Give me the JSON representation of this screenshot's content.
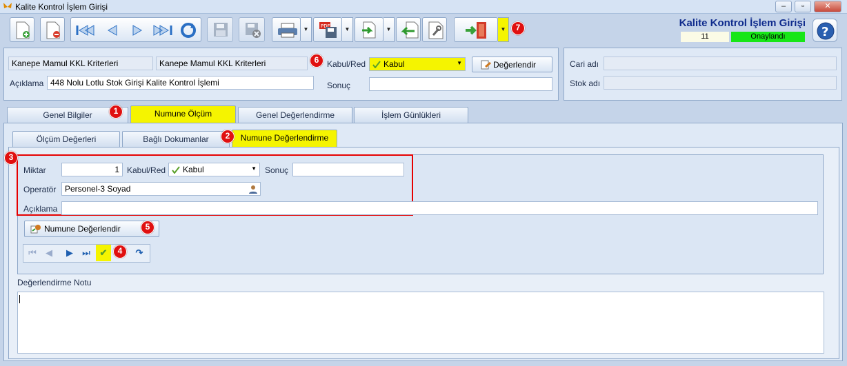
{
  "window": {
    "title": "Kalite Kontrol İşlem Girişi"
  },
  "header": {
    "title": "Kalite Kontrol İşlem Girişi",
    "record_no": "11",
    "status": "Onaylandı",
    "status_color": "#17e617"
  },
  "top": {
    "criteria1": "Kanepe Mamul KKL Kriterleri",
    "criteria2": "Kanepe Mamul KKL Kriterleri",
    "aciklama_label": "Açıklama",
    "aciklama_value": "448 Nolu Lotlu Stok Girişi Kalite Kontrol İşlemi",
    "kabulred_label": "Kabul/Red",
    "kabulred_value": "Kabul",
    "sonuc_label": "Sonuç",
    "sonuc_value": "",
    "degerlendir_label": "Değerlendir",
    "cari_label": "Cari adı",
    "stok_label": "Stok adı"
  },
  "tabs": [
    "Genel Bilgiler",
    "Numune Ölçüm",
    "Genel Değerlendirme",
    "İşlem Günlükleri"
  ],
  "subtabs": [
    "Ölçüm Değerleri",
    "Bağlı Dokumanlar",
    "Numune Değerlendirme"
  ],
  "form": {
    "miktar_label": "Miktar",
    "miktar_value": "1",
    "kabulred_label": "Kabul/Red",
    "kabulred_value": "Kabul",
    "sonuc_label": "Sonuç",
    "sonuc_value": "",
    "operator_label": "Operatör",
    "operator_value": "Personel-3 Soyad",
    "aciklama_label": "Açıklama",
    "aciklama_value": ""
  },
  "numune_button": "Numune Değerlendir",
  "note_label": "Değerlendirme Notu",
  "badges": [
    "1",
    "2",
    "3",
    "4",
    "5",
    "6",
    "7"
  ],
  "colors": {
    "highlight": "#f5f400",
    "badge": "#e01010",
    "frame": "#e60000"
  }
}
